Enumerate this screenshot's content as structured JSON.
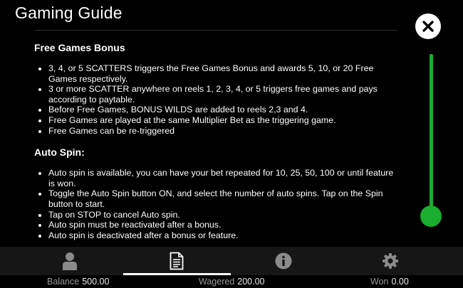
{
  "header": {
    "title": "Gaming Guide"
  },
  "sections": [
    {
      "title": "Free Games Bonus",
      "items": [
        "3, 4, or 5 SCATTERS triggers the Free Games Bonus and awards 5, 10, or 20 Free Games respectively.",
        "3 or more SCATTER anywhere on reels 1, 2, 3, 4, or 5 triggers free games and pays according to paytable.",
        "Before Free Games, BONUS WILDS are added to reels 2,3 and 4.",
        "Free Games are played at the same Multiplier Bet as the triggering game.",
        "Free Games can be re-triggered"
      ]
    },
    {
      "title": "Auto Spin:",
      "items": [
        "Auto spin is available, you can have your bet repeated for 10, 25, 50, 100 or until feature is won.",
        "Toggle the Auto Spin button ON, and select the number of auto spins. Tap on the Spin button to start.",
        "Tap on STOP to cancel Auto spin.",
        "Auto spin must be reactivated after a bonus.",
        "Auto spin is deactivated after a bonus or feature."
      ]
    }
  ],
  "tabs": [
    {
      "icon": "user-icon",
      "active": false
    },
    {
      "icon": "document-icon",
      "active": true
    },
    {
      "icon": "info-icon",
      "active": false
    },
    {
      "icon": "gear-icon",
      "active": false
    }
  ],
  "footer": {
    "balance_label": "Balance",
    "balance_value": "500.00",
    "wagered_label": "Wagered",
    "wagered_value": "200.00",
    "won_label": "Won",
    "won_value": "0.00"
  },
  "colors": {
    "accent": "#1aad2e",
    "background": "#000000",
    "tabbar": "#161616"
  }
}
